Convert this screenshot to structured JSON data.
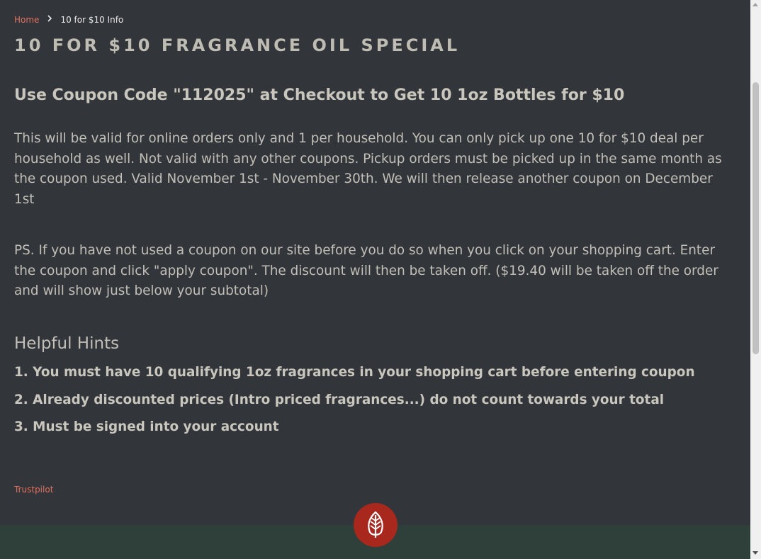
{
  "breadcrumb": {
    "home_label": "Home",
    "separator_icon": "chevron-right-icon",
    "current_label": "10 for $10 Info"
  },
  "main": {
    "title": "10 FOR $10 FRAGRANCE OIL SPECIAL",
    "coupon_heading": "Use Coupon Code \"112025\" at Checkout to Get 10 1oz Bottles for $10",
    "paragraph_1": "This will be valid for online orders only and 1 per household. You can only pick up one 10 for $10 deal per household as well. Not valid with any other coupons. Pickup orders must be picked up in the same month as the coupon used. Valid November 1st - November 30th. We will then release another coupon on December 1st",
    "paragraph_2": "PS. If you have not used a coupon on our site before you do so when you click on your shopping cart. Enter the coupon and click \"apply coupon\". The discount will then be taken off. ($19.40 will be taken off the order and will show just below your subtotal)",
    "hints_heading": "Helpful Hints",
    "hints": [
      "1. You must have 10 qualifying 1oz fragrances in your shopping cart before entering coupon",
      "2. Already discounted prices (Intro priced fragrances...) do not count towards your total",
      "3. Must be signed into your account"
    ]
  },
  "footer": {
    "trustpilot_label": "Trustpilot",
    "logo_icon": "leaf-logo-icon"
  },
  "colors": {
    "background": "#32363a",
    "link": "#e07060",
    "text": "#c2bfb8",
    "footer_band": "#2f3f3a",
    "logo_badge": "#a8281e"
  }
}
